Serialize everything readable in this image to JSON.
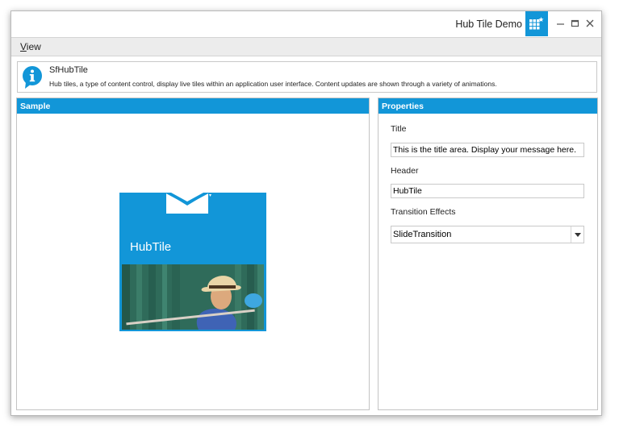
{
  "window": {
    "title": "Hub Tile Demo",
    "accent_color": "#1296d8",
    "icons": [
      "app-tile-icon",
      "minimize-icon",
      "maximize-icon",
      "close-icon"
    ]
  },
  "menu": {
    "view_accelerator": "V",
    "view_rest": "iew"
  },
  "info": {
    "title": "SfHubTile",
    "description": "Hub tiles, a type of content control, display live tiles within an application user interface. Content updates are shown through a variety of animations.",
    "icon": "info-icon"
  },
  "sample": {
    "header": "Sample",
    "tile": {
      "label": "HubTile",
      "icons": [
        "mail-icon"
      ],
      "image": "woman playing flute"
    }
  },
  "properties": {
    "header": "Properties",
    "title_label": "Title",
    "title_value": "This is the title area. Display your message here.",
    "header_label": "Header",
    "header_value": "HubTile",
    "transition_label": "Transition Effects",
    "transition_value": "SlideTransition"
  }
}
